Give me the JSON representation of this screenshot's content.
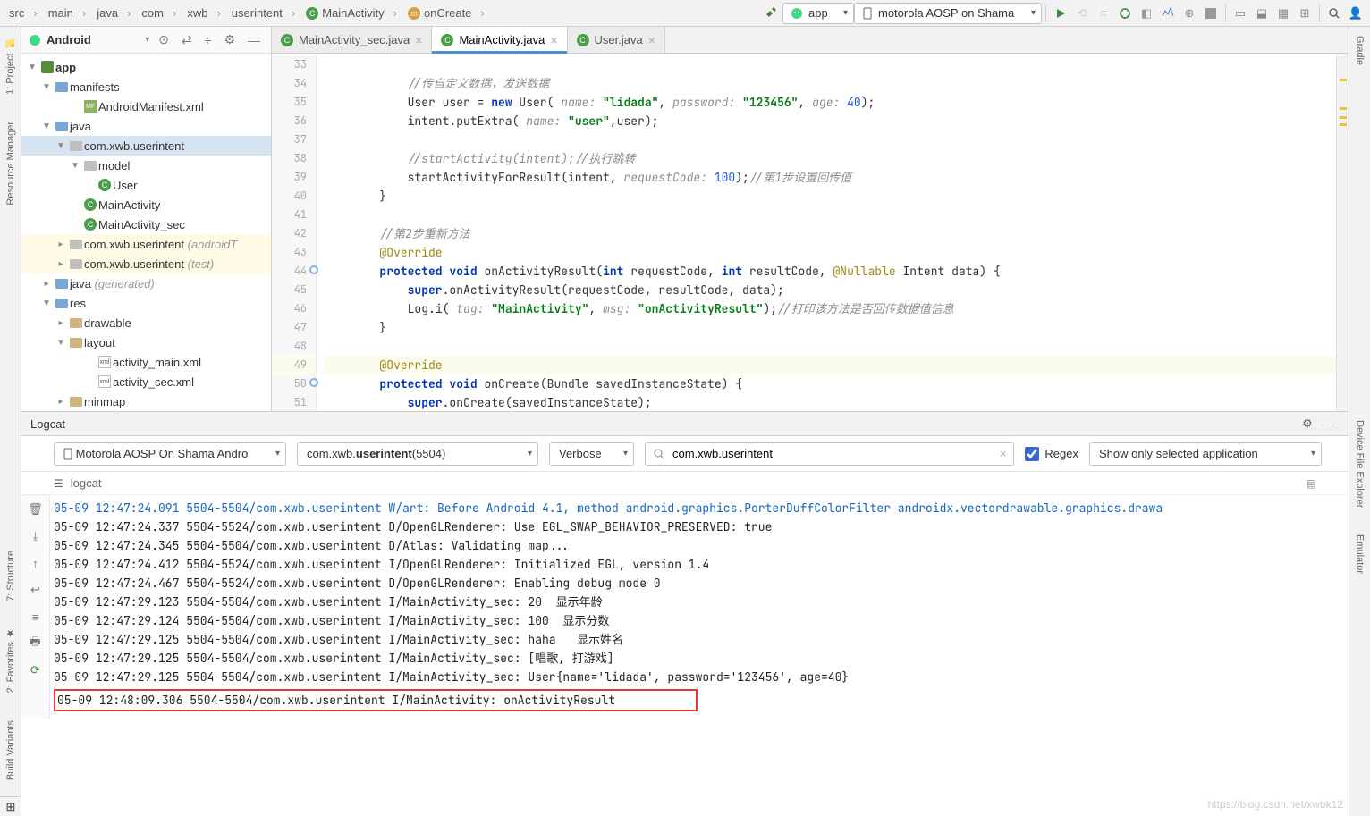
{
  "breadcrumbs": [
    "src",
    "main",
    "java",
    "com",
    "xwb",
    "userintent",
    "MainActivity",
    "onCreate"
  ],
  "runConfig": "app",
  "device": "motorola AOSP on Shama",
  "leftTools": {
    "project": "1: Project",
    "resmgr": "Resource Manager"
  },
  "rightTools": {
    "gradle": "Gradle",
    "devexp": "Device File Explorer",
    "emu": "Emulator"
  },
  "leftTools2": {
    "struct": "7: Structure",
    "fav": "2: Favorites",
    "bv": "Build Variants"
  },
  "projectPanel": {
    "mode": "Android"
  },
  "tree": {
    "app": "app",
    "manifests": "manifests",
    "manifest": "AndroidManifest.xml",
    "java": "java",
    "pkg": "com.xwb.userintent",
    "model": "model",
    "user": "User",
    "mainact": "MainActivity",
    "mainactsec": "MainActivity_sec",
    "pkgAT": "com.xwb.userintent",
    "pkgATs": "(androidT",
    "pkgT": "com.xwb.userintent",
    "pkgTs": "(test)",
    "javaGen": "java",
    "gen": "(generated)",
    "res": "res",
    "drawable": "drawable",
    "layout": "layout",
    "layMain": "activity_main.xml",
    "laySec": "activity_sec.xml",
    "mipmap": "minmap"
  },
  "tabs": [
    {
      "label": "MainActivity_sec.java"
    },
    {
      "label": "MainActivity.java"
    },
    {
      "label": "User.java"
    }
  ],
  "code": {
    "startLine": 33,
    "lines": [
      {
        "n": 33,
        "t": ""
      },
      {
        "n": 34,
        "t": "            <span class='com'>//传自定义数据，发送数据</span>"
      },
      {
        "n": 35,
        "t": "            User user = <span class='kw'>new</span> User( <span class='param'>name:</span> <span class='str'>\"lidada\"</span>, <span class='param'>password:</span> <span class='str'>\"123456\"</span>, <span class='param'>age:</span> <span class='num'>40</span>);"
      },
      {
        "n": 36,
        "t": "            intent.putExtra( <span class='param'>name:</span> <span class='str'>\"user\"</span>,user);"
      },
      {
        "n": 37,
        "t": ""
      },
      {
        "n": 38,
        "t": "            <span class='com'>//startActivity(intent);//执行跳转</span>"
      },
      {
        "n": 39,
        "t": "            startActivityForResult(intent, <span class='param'>requestCode:</span> <span class='num'>100</span>);<span class='com'>//第1步设置回传值</span>"
      },
      {
        "n": 40,
        "t": "        }"
      },
      {
        "n": 41,
        "t": ""
      },
      {
        "n": 42,
        "t": "        <span class='com'>//第2步重新方法</span>"
      },
      {
        "n": 43,
        "t": "        <span class='ann'>@Override</span>"
      },
      {
        "n": 44,
        "t": "        <span class='kw'>protected</span> <span class='kw'>void</span> <span class='fn'>onActivityResult</span>(<span class='kw'>int</span> requestCode, <span class='kw'>int</span> resultCode, <span class='ann'>@Nullable</span> Intent data) {",
        "ovr": true
      },
      {
        "n": 45,
        "t": "            <span class='kw'>super</span>.onActivityResult(requestCode, resultCode, data);"
      },
      {
        "n": 46,
        "t": "            Log.<span class='fn'>i</span>( <span class='param'>tag:</span> <span class='str'>\"MainActivity\"</span>, <span class='param'>msg:</span> <span class='str'>\"onActivityResult\"</span>);<span class='com'>//打印该方法是否回传数据值信息</span>"
      },
      {
        "n": 47,
        "t": "        }"
      },
      {
        "n": 48,
        "t": ""
      },
      {
        "n": 49,
        "t": "        <span class='ann'>@Override</span>",
        "hl": true
      },
      {
        "n": 50,
        "t": "        <span class='kw'>protected</span> <span class='kw'>void</span> <span class='fn'>onCreate</span>(Bundle savedInstanceState) {",
        "ovr": true
      },
      {
        "n": 51,
        "t": "            <span class='kw'>super</span>.onCreate(savedInstanceState);"
      }
    ]
  },
  "logcat": {
    "title": "Logcat",
    "device": "Motorola AOSP On Shama Andro",
    "process": "com.xwb.<b>userintent</b> (5504)",
    "level": "Verbose",
    "search": "com.xwb.userintent",
    "regex": "Regex",
    "filter": "Show only selected application",
    "sub": "logcat",
    "lines": [
      {
        "cls": "log-warn",
        "t": "05-09 12:47:24.091 5504-5504/com.xwb.userintent W/art: Before Android 4.1, method android.graphics.PorterDuffColorFilter androidx.vectordrawable.graphics.drawa"
      },
      {
        "cls": "",
        "t": "05-09 12:47:24.337 5504-5524/com.xwb.userintent D/OpenGLRenderer: Use EGL_SWAP_BEHAVIOR_PRESERVED: true"
      },
      {
        "cls": "",
        "t": "05-09 12:47:24.345 5504-5504/com.xwb.userintent D/Atlas: Validating map..."
      },
      {
        "cls": "",
        "t": "05-09 12:47:24.412 5504-5524/com.xwb.userintent I/OpenGLRenderer: Initialized EGL, version 1.4"
      },
      {
        "cls": "",
        "t": "05-09 12:47:24.467 5504-5524/com.xwb.userintent D/OpenGLRenderer: Enabling debug mode 0"
      },
      {
        "cls": "",
        "t": "05-09 12:47:29.123 5504-5504/com.xwb.userintent I/MainActivity_sec: 20  显示年龄"
      },
      {
        "cls": "",
        "t": "05-09 12:47:29.124 5504-5504/com.xwb.userintent I/MainActivity_sec: 100  显示分数"
      },
      {
        "cls": "",
        "t": "05-09 12:47:29.125 5504-5504/com.xwb.userintent I/MainActivity_sec: haha   显示姓名"
      },
      {
        "cls": "",
        "t": "05-09 12:47:29.125 5504-5504/com.xwb.userintent I/MainActivity_sec: [唱歌, 打游戏]"
      },
      {
        "cls": "",
        "t": "05-09 12:47:29.125 5504-5504/com.xwb.userintent I/MainActivity_sec: User{name='lidada', password='123456', age=40}"
      }
    ],
    "highlighted": "05-09 12:48:09.306 5504-5504/com.xwb.userintent I/MainActivity: onActivityResult"
  },
  "watermark": "https://blog.csdn.net/xwbk12"
}
